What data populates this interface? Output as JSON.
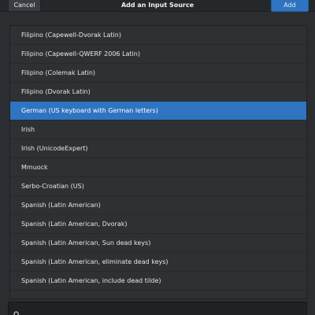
{
  "header": {
    "cancel_label": "Cancel",
    "title": "Add an Input Source",
    "add_label": "Add"
  },
  "list": {
    "selected_index": 4,
    "items": [
      "Filipino (Capewell-Dvorak Latin)",
      "Filipino (Capewell-QWERF 2006 Latin)",
      "Filipino (Colemak Latin)",
      "Filipino (Dvorak Latin)",
      "German (US keyboard with German letters)",
      "Irish",
      "Irish (UnicodeExpert)",
      "Mmuock",
      "Serbo-Croatian (US)",
      "Spanish (Latin American)",
      "Spanish (Latin American, Dvorak)",
      "Spanish (Latin American, Sun dead keys)",
      "Spanish (Latin American, eliminate dead keys)",
      "Spanish (Latin American, include dead tilde)"
    ]
  },
  "search": {
    "value": "",
    "icon": "search-icon"
  },
  "colors": {
    "accent": "#2f74c0",
    "background": "#2b2e31"
  }
}
